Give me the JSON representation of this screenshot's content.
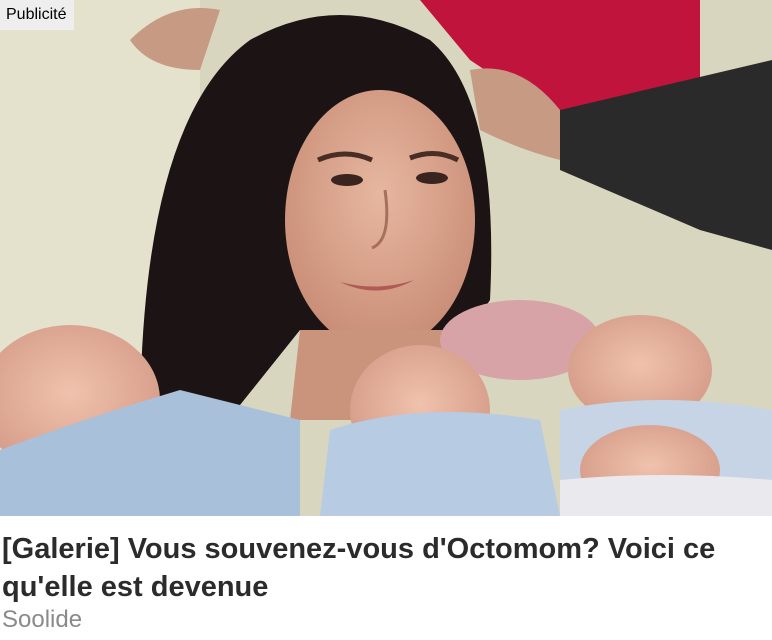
{
  "ad": {
    "badge_label": "Publicité",
    "headline": "[Galerie] Vous souvenez-vous d'Octomom? Voici ce qu'elle est devenue",
    "source": "Soolide",
    "image_alt": "Mother with dark hair holding several sleeping newborn babies"
  },
  "colors": {
    "headline": "#2b2b2b",
    "source": "#8a8a8a",
    "badge_bg": "#eeeeee"
  }
}
